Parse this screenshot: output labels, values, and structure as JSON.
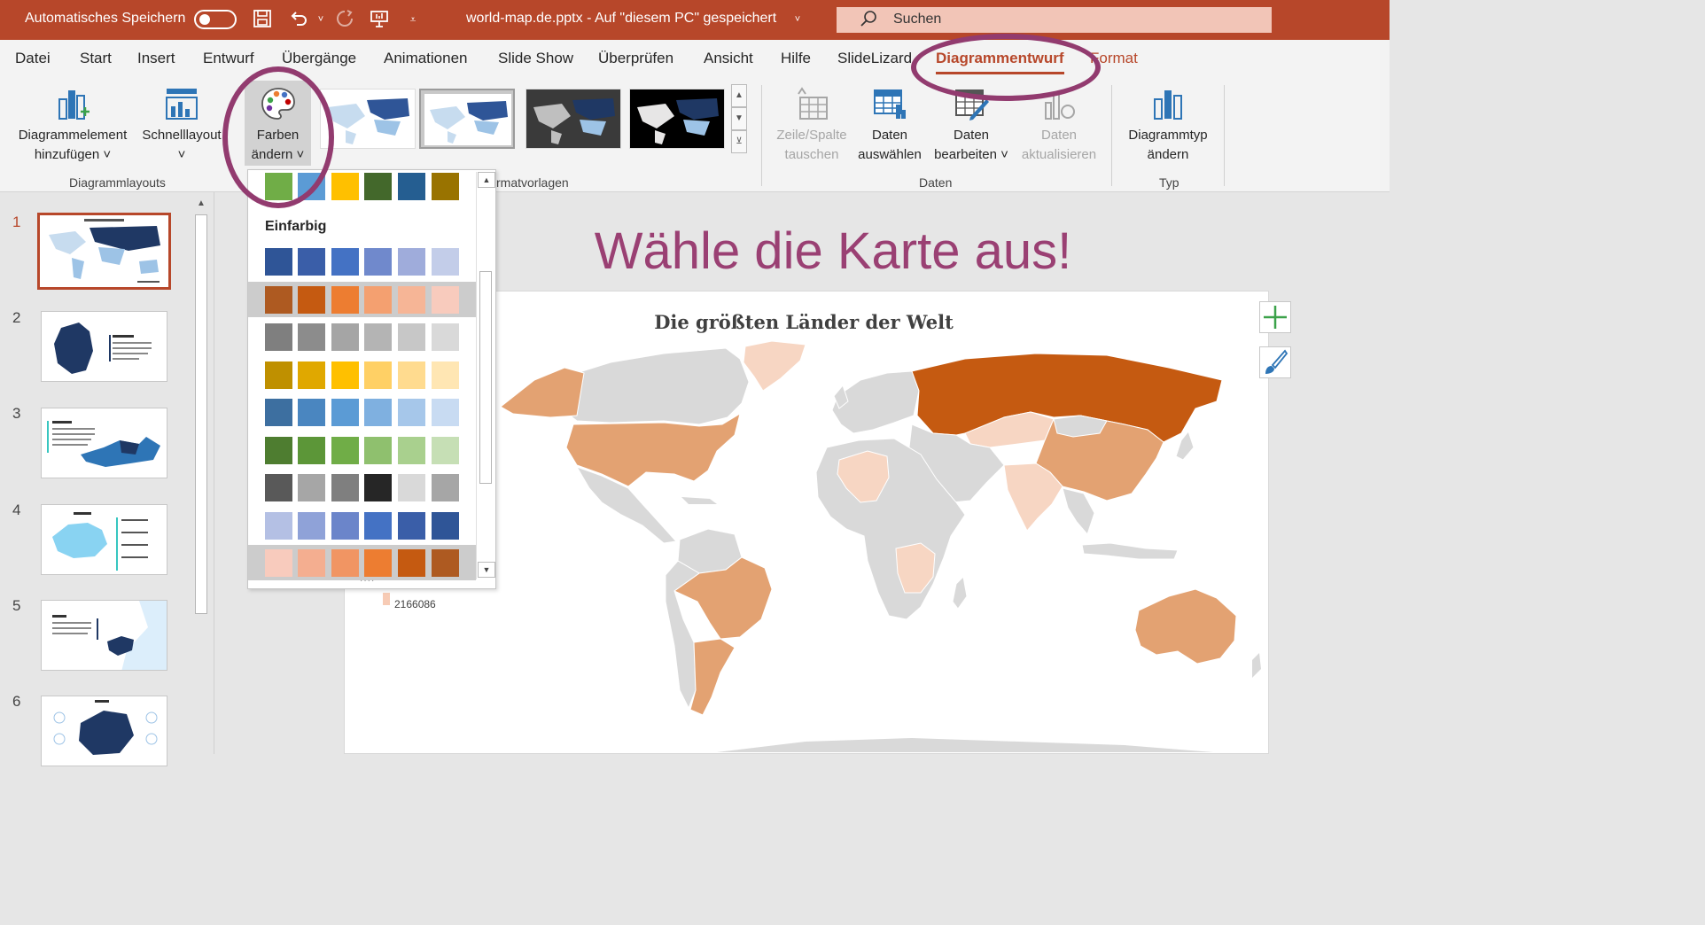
{
  "titlebar": {
    "autosave_label": "Automatisches Speichern",
    "file_label": "world-map.de.pptx  -  Auf \"diesem PC\" gespeichert",
    "search_placeholder": "Suchen"
  },
  "menu": {
    "tabs": [
      "Datei",
      "Start",
      "Insert",
      "Entwurf",
      "Übergänge",
      "Animationen",
      "Slide Show",
      "Überprüfen",
      "Ansicht",
      "Hilfe",
      "SlideLizard",
      "Diagrammentwurf",
      "Format"
    ],
    "active": "Diagrammentwurf"
  },
  "ribbon": {
    "add_element": [
      "Diagrammelement",
      "hinzufügen ˅"
    ],
    "quick_layout": [
      "Schnelllayout",
      "˅"
    ],
    "change_colors": [
      "Farben",
      "ändern ˅"
    ],
    "group_layouts": "Diagrammlayouts",
    "group_styles": "rmatvorlagen",
    "switch_rowcol": [
      "Zeile/Spalte",
      "tauschen"
    ],
    "select_data": [
      "Daten",
      "auswählen"
    ],
    "edit_data": [
      "Daten",
      "bearbeiten ˅"
    ],
    "refresh_data": [
      "Daten",
      "aktualisieren"
    ],
    "group_data": "Daten",
    "change_type": [
      "Diagrammtyp",
      "ändern"
    ],
    "group_type": "Typ"
  },
  "thumbnails": [
    "1",
    "2",
    "3",
    "4",
    "5",
    "6"
  ],
  "dropdown": {
    "heading": "Einfarbig",
    "top_row": [
      "#70ad47",
      "#5b9bd5",
      "#ffc000",
      "#43682b",
      "#255e91",
      "#997300"
    ],
    "rows": [
      [
        "#2f5597",
        "#3a5ea8",
        "#4472c4",
        "#7089cc",
        "#9facdb",
        "#c3cde9"
      ],
      [
        "#ae5a21",
        "#c55a11",
        "#ed7d31",
        "#f4a070",
        "#f6b596",
        "#f8cbbd"
      ],
      [
        "#7f7f7f",
        "#8c8c8c",
        "#a5a5a5",
        "#b4b4b4",
        "#c7c7c7",
        "#d9d9d9"
      ],
      [
        "#bf9000",
        "#e0a800",
        "#ffc000",
        "#ffd065",
        "#ffdb8f",
        "#ffe6b3"
      ],
      [
        "#3d6fa0",
        "#4a86c0",
        "#5b9bd5",
        "#7fb0e0",
        "#a6c7ea",
        "#c8dbf2"
      ],
      [
        "#4e7d30",
        "#5c9638",
        "#70ad47",
        "#8fc06e",
        "#a9d08e",
        "#c6dfb5"
      ],
      [
        "#595959",
        "#a6a6a6",
        "#7f7f7f",
        "#262626",
        "#d9d9d9",
        "#a6a6a6"
      ],
      [
        "#b4c0e4",
        "#8fa2d8",
        "#6b85ca",
        "#4472c4",
        "#3a5ea8",
        "#2f5597"
      ],
      [
        "#f8cbbd",
        "#f4ae90",
        "#f19563",
        "#ed7d31",
        "#c55a11",
        "#ae5a21"
      ]
    ]
  },
  "slide": {
    "title": "Wähle die Karte aus!",
    "chart_title": "Die größten Länder der Welt",
    "legend_value": "2166086"
  },
  "colors": {
    "accent": "#b7472a",
    "title_purple": "#9a4073",
    "map_grey": "#d9d9d9",
    "map_dark": "#c55a11",
    "map_mid": "#e3a272",
    "map_light": "#f7d6c3"
  }
}
